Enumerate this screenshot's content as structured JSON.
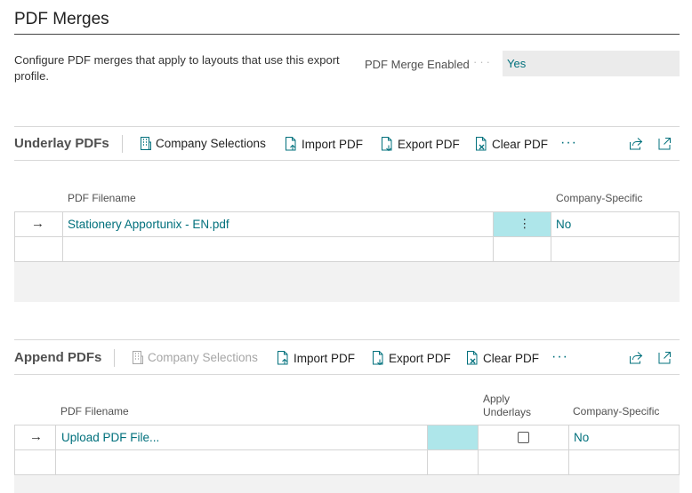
{
  "page": {
    "title": "PDF Merges",
    "description": "Configure PDF merges that apply to layouts that use this export profile.",
    "field_label": "PDF Merge Enabled",
    "field_value": "Yes"
  },
  "underlay": {
    "title": "Underlay PDFs",
    "actions": {
      "company_selections": "Company Selections",
      "import_pdf": "Import PDF",
      "export_pdf": "Export PDF",
      "clear_pdf": "Clear PDF",
      "more": "···"
    },
    "columns": {
      "filename": "PDF Filename",
      "company_specific": "Company-Specific"
    },
    "rows": [
      {
        "filename": "Stationery Apportunix - EN.pdf",
        "company_specific": "No",
        "row_menu": "⋮"
      }
    ]
  },
  "append": {
    "title": "Append PDFs",
    "actions": {
      "company_selections": "Company Selections",
      "import_pdf": "Import PDF",
      "export_pdf": "Export PDF",
      "clear_pdf": "Clear PDF",
      "more": "···"
    },
    "columns": {
      "filename": "PDF Filename",
      "apply_underlays_1": "Apply",
      "apply_underlays_2": "Underlays",
      "company_specific": "Company-Specific"
    },
    "rows": [
      {
        "filename": "Upload PDF File...",
        "apply_underlays": false,
        "company_specific": "No"
      }
    ]
  },
  "icons": {
    "company_selections": "building-icon",
    "import_pdf": "import-document-icon",
    "export_pdf": "export-document-icon",
    "clear_pdf": "clear-document-icon",
    "share": "share-icon",
    "expand": "expand-icon",
    "row_arrow": "arrow-right-icon"
  },
  "colors": {
    "accent": "#00707c",
    "selected_cell": "#aee6ea",
    "field_bg": "#ebebeb"
  }
}
